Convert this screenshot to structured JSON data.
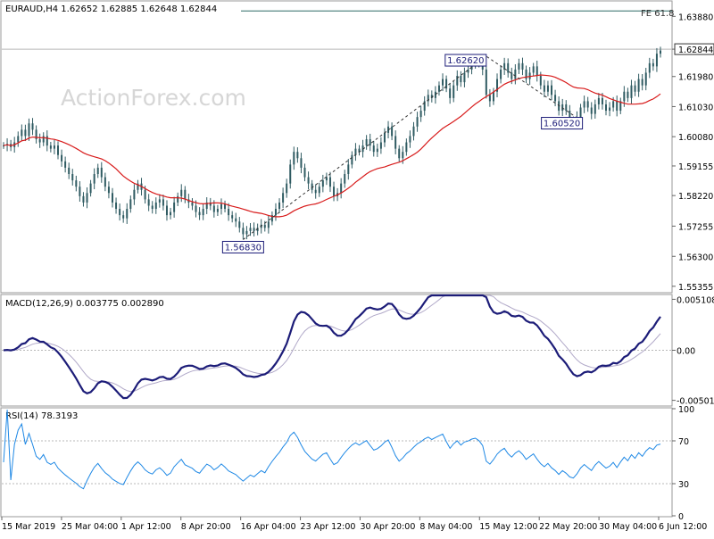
{
  "chart_data": [
    {
      "type": "line",
      "panel": "price",
      "title": "EURAUD,H4  1.62652 1.62885 1.62648 1.62844",
      "watermark": "ActionForex.com",
      "ylim": [
        1.5518,
        1.6434
      ],
      "y_ticks": [
        "1.63880",
        "1.62844",
        "1.61980",
        "1.61030",
        "1.60080",
        "1.59155",
        "1.58220",
        "1.57255",
        "1.56300",
        "1.55355"
      ],
      "y_tick_values": [
        1.6388,
        1.62844,
        1.6198,
        1.6103,
        1.6008,
        1.59155,
        1.5822,
        1.57255,
        1.563,
        1.55355
      ],
      "x_ticks": [
        "15 Mar 2019",
        "25 Mar 04:00",
        "1 Apr 12:00",
        "8 Apr 20:00",
        "16 Apr 04:00",
        "23 Apr 12:00",
        "30 Apr 20:00",
        "8 May 04:00",
        "15 May 12:00",
        "22 May 20:00",
        "30 May 04:00",
        "6 Jun 12:00"
      ],
      "current_price": "1.62844",
      "current_value": 1.62844,
      "fe_label": "FE 61.8",
      "fe_level": 1.6405,
      "annotations": [
        {
          "label": "1.56830",
          "value": 1.5683,
          "bar": 66
        },
        {
          "label": "1.62620",
          "value": 1.6262,
          "bar": 133
        },
        {
          "label": "1.60520",
          "value": 1.6052,
          "bar": 160
        }
      ],
      "swing_path_bars": [
        66,
        133,
        160
      ],
      "close": [
        1.598,
        1.5985,
        1.5975,
        1.599,
        1.601,
        1.603,
        1.601,
        1.605,
        1.603,
        1.6,
        1.599,
        1.601,
        1.598,
        1.597,
        1.598,
        1.595,
        1.593,
        1.591,
        1.589,
        1.587,
        1.585,
        1.582,
        1.58,
        1.583,
        1.586,
        1.589,
        1.591,
        1.588,
        1.585,
        1.583,
        1.58,
        1.578,
        1.576,
        1.575,
        1.578,
        1.581,
        1.584,
        1.586,
        1.584,
        1.581,
        1.579,
        1.578,
        1.58,
        1.581,
        1.579,
        1.576,
        1.577,
        1.58,
        1.582,
        1.584,
        1.581,
        1.58,
        1.579,
        1.577,
        1.576,
        1.578,
        1.58,
        1.579,
        1.577,
        1.578,
        1.5795,
        1.578,
        1.576,
        1.575,
        1.574,
        1.572,
        1.57,
        1.571,
        1.572,
        1.571,
        1.572,
        1.573,
        1.572,
        1.574,
        1.576,
        1.578,
        1.58,
        1.583,
        1.586,
        1.592,
        1.596,
        1.594,
        1.591,
        1.588,
        1.586,
        1.584,
        1.583,
        1.585,
        1.587,
        1.588,
        1.585,
        1.582,
        1.583,
        1.586,
        1.589,
        1.592,
        1.595,
        1.597,
        1.596,
        1.598,
        1.6,
        1.598,
        1.596,
        1.597,
        1.599,
        1.602,
        1.604,
        1.601,
        1.597,
        1.594,
        1.596,
        1.599,
        1.601,
        1.604,
        1.607,
        1.609,
        1.612,
        1.614,
        1.613,
        1.615,
        1.617,
        1.619,
        1.616,
        1.613,
        1.617,
        1.62,
        1.618,
        1.621,
        1.622,
        1.624,
        1.625,
        1.624,
        1.622,
        1.614,
        1.612,
        1.615,
        1.619,
        1.622,
        1.624,
        1.621,
        1.619,
        1.622,
        1.624,
        1.622,
        1.619,
        1.621,
        1.623,
        1.62,
        1.617,
        1.615,
        1.617,
        1.614,
        1.612,
        1.609,
        1.611,
        1.609,
        1.606,
        1.605,
        1.607,
        1.61,
        1.612,
        1.61,
        1.608,
        1.611,
        1.613,
        1.611,
        1.609,
        1.61,
        1.612,
        1.609,
        1.612,
        1.615,
        1.613,
        1.617,
        1.615,
        1.619,
        1.617,
        1.621,
        1.624,
        1.623,
        1.627,
        1.628
      ]
    },
    {
      "type": "line",
      "panel": "macd",
      "title": "MACD(12,26,9) 0.003775 0.002890",
      "ylim": [
        -0.0055,
        0.0055
      ],
      "y_ticks": [
        "0.005108",
        "0.00",
        "-0.005019"
      ],
      "y_tick_values": [
        0.005108,
        0.0,
        -0.005019
      ]
    },
    {
      "type": "line",
      "panel": "rsi",
      "title": "RSI(14) 78.3193",
      "ylim": [
        0,
        100
      ],
      "y_ticks": [
        "100",
        "70",
        "30",
        "0"
      ],
      "y_tick_values": [
        100,
        70,
        30,
        0
      ],
      "guides": [
        70,
        30
      ]
    }
  ],
  "colors": {
    "background": "#ffffff",
    "candle": "#2f5b62",
    "moving_average": "#d81b1b",
    "macd_line": "#1c1c78",
    "signal_line": "#b0a8c8",
    "rsi_line": "#1e88e5",
    "label_box": "#1c1c78",
    "fe_line": "#2b6a66",
    "grid": "#b8b8b8",
    "frame": "#999999",
    "watermark": "#d6d6d6"
  }
}
